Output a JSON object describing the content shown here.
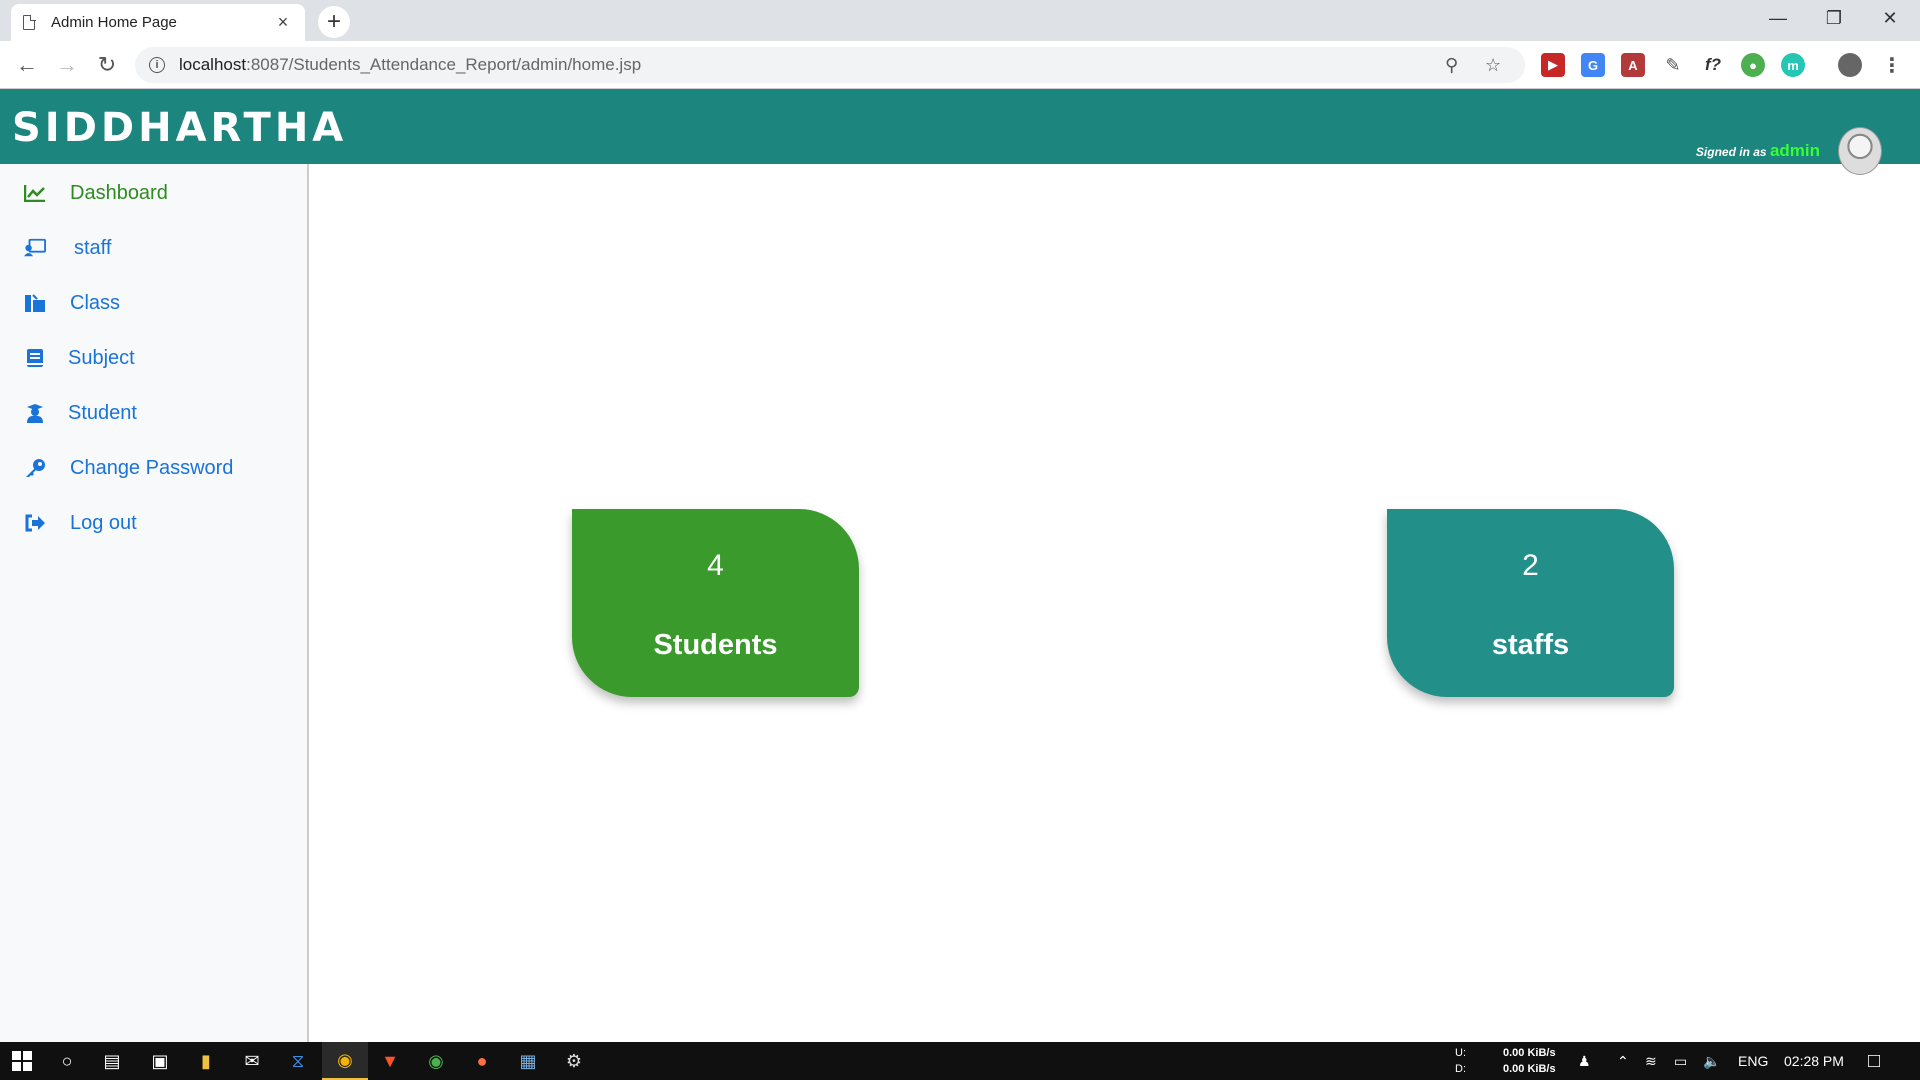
{
  "browser": {
    "tab_title": "Admin Home Page",
    "tab_close": "×",
    "new_tab": "+",
    "url_host": "localhost",
    "url_path": ":8087/Students_Attendance_Report/admin/home.jsp",
    "window_controls": [
      "minimize-icon",
      "restore-icon",
      "close-icon"
    ]
  },
  "header": {
    "brand": "SIDDHARTHA",
    "signed_in_prefix": "Signed in as ",
    "username": "admin"
  },
  "sidebar": {
    "items": [
      {
        "label": "Dashboard",
        "icon": "chart-line-icon",
        "active": true
      },
      {
        "label": "staff",
        "icon": "chalkboard-teacher-icon"
      },
      {
        "label": "Class",
        "icon": "school-icon"
      },
      {
        "label": "Subject",
        "icon": "book-icon"
      },
      {
        "label": "Student",
        "icon": "user-graduate-icon"
      },
      {
        "label": "Change Password",
        "icon": "key-icon"
      },
      {
        "label": "Log out",
        "icon": "sign-out-icon"
      }
    ]
  },
  "cards": [
    {
      "count": "4",
      "label": "Students",
      "color": "#3a9a2c"
    },
    {
      "count": "2",
      "label": "staffs",
      "color": "#238f89"
    }
  ],
  "taskbar": {
    "net_up_label": "U:",
    "net_down_label": "D:",
    "net_up": "0.00 KiB/s",
    "net_down": "0.00 KiB/s",
    "lang": "ENG",
    "time": "02:28 PM"
  },
  "colors": {
    "header": "#1c857e",
    "sidebar_link": "#1a73d9",
    "sidebar_active": "#2e8b1f"
  }
}
